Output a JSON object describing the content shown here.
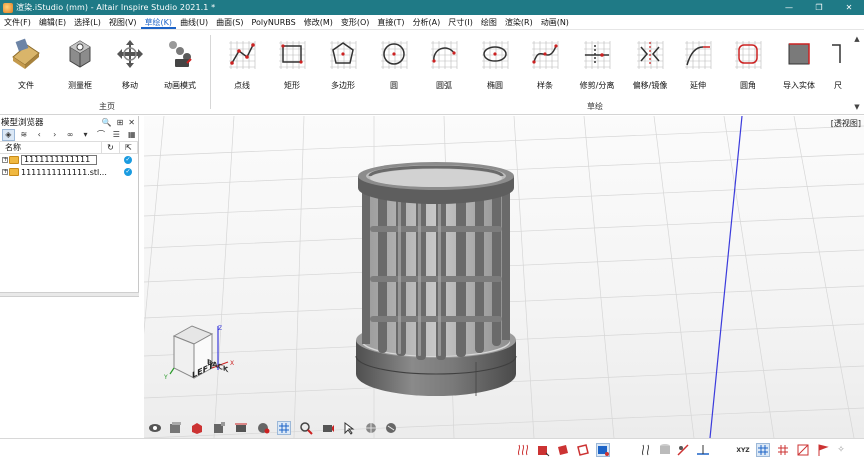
{
  "window": {
    "title": "渲染.iStudio (mm) - Altair Inspire Studio 2021.1 *",
    "minimize": "—",
    "restore": "❐",
    "close": "✕"
  },
  "menu": {
    "items": [
      "文件(F)",
      "编辑(E)",
      "选择(L)",
      "视图(V)",
      "草绘(K)",
      "曲线(U)",
      "曲面(S)",
      "PolyNURBS",
      "修改(M)",
      "变形(O)",
      "直接(T)",
      "分析(A)",
      "尺寸(I)",
      "绘图",
      "渲染(R)",
      "动画(N)"
    ],
    "active_index": 4
  },
  "ribbon": {
    "main_group": "主页",
    "sketch_group": "草绘",
    "buttons": {
      "file": "文件",
      "measure": "测量框",
      "move": "移动",
      "animation_mode": "动画模式",
      "point_line": "点线",
      "rectangle": "矩形",
      "polygon": "多边形",
      "circle": "圆",
      "arc": "圆弧",
      "ellipse": "椭圆",
      "spline": "样条",
      "trim_split": "修剪/分离",
      "offset_mirror": "偏移/镜像",
      "extend": "延伸",
      "fillet": "圆角",
      "import_solid": "导入实体",
      "dimension": "尺"
    }
  },
  "browser": {
    "title": "模型浏览器",
    "column_name": "名称",
    "rows": [
      {
        "name": "1111111111111",
        "visible": true
      },
      {
        "name": "1111111111111.stl...",
        "visible": true
      }
    ]
  },
  "viewport": {
    "view_name": "[透视图]",
    "cube_face_front": "LEFT",
    "cube_face_side": "BACK",
    "axis_z": "Z",
    "axis_x": "X",
    "axis_y": "Y"
  },
  "status": {
    "snap_label": "XYZ"
  },
  "colors": {
    "titlebar": "#1f7a86",
    "accent": "#1c63c7",
    "model": "#6f6f6f",
    "axis_blue": "#3b3bdc"
  }
}
